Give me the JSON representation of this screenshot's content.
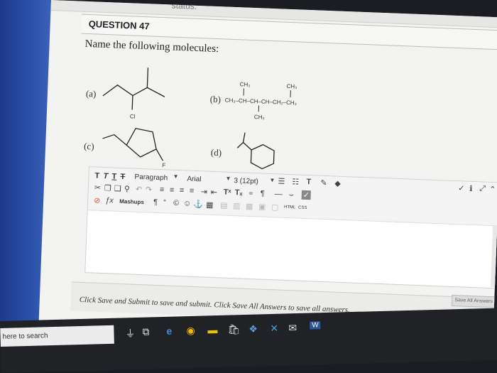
{
  "page": {
    "status_fragment": "status."
  },
  "question": {
    "title": "QUESTION 47",
    "prompt": "Name the following molecules:"
  },
  "molecules": {
    "a": {
      "label": "(a)",
      "substituent": "Cl"
    },
    "b": {
      "label": "(b)",
      "top_left": "CH₃",
      "top_right": "CH₃",
      "chain": "CH₃–CH–CH–CH–CH₂–CH₃",
      "bottom": "CH₃"
    },
    "c": {
      "label": "(c)",
      "substituent": "F"
    },
    "d": {
      "label": "(d)"
    }
  },
  "editor": {
    "format_buttons": [
      "T",
      "T",
      "T",
      "T"
    ],
    "paragraph": "Paragraph",
    "font": "Arial",
    "size": "3 (12pt)",
    "mashups": "Mashups",
    "html_label": "HTML",
    "css_label": "CSS"
  },
  "footer": {
    "message": "Click Save and Submit to save and submit. Click Save All Answers to save all answers.",
    "save_all": "Save All Answers"
  },
  "taskbar": {
    "search": "here to search"
  },
  "colors": {
    "bezel": "#2a4fa8",
    "taskbar": "#202226"
  }
}
